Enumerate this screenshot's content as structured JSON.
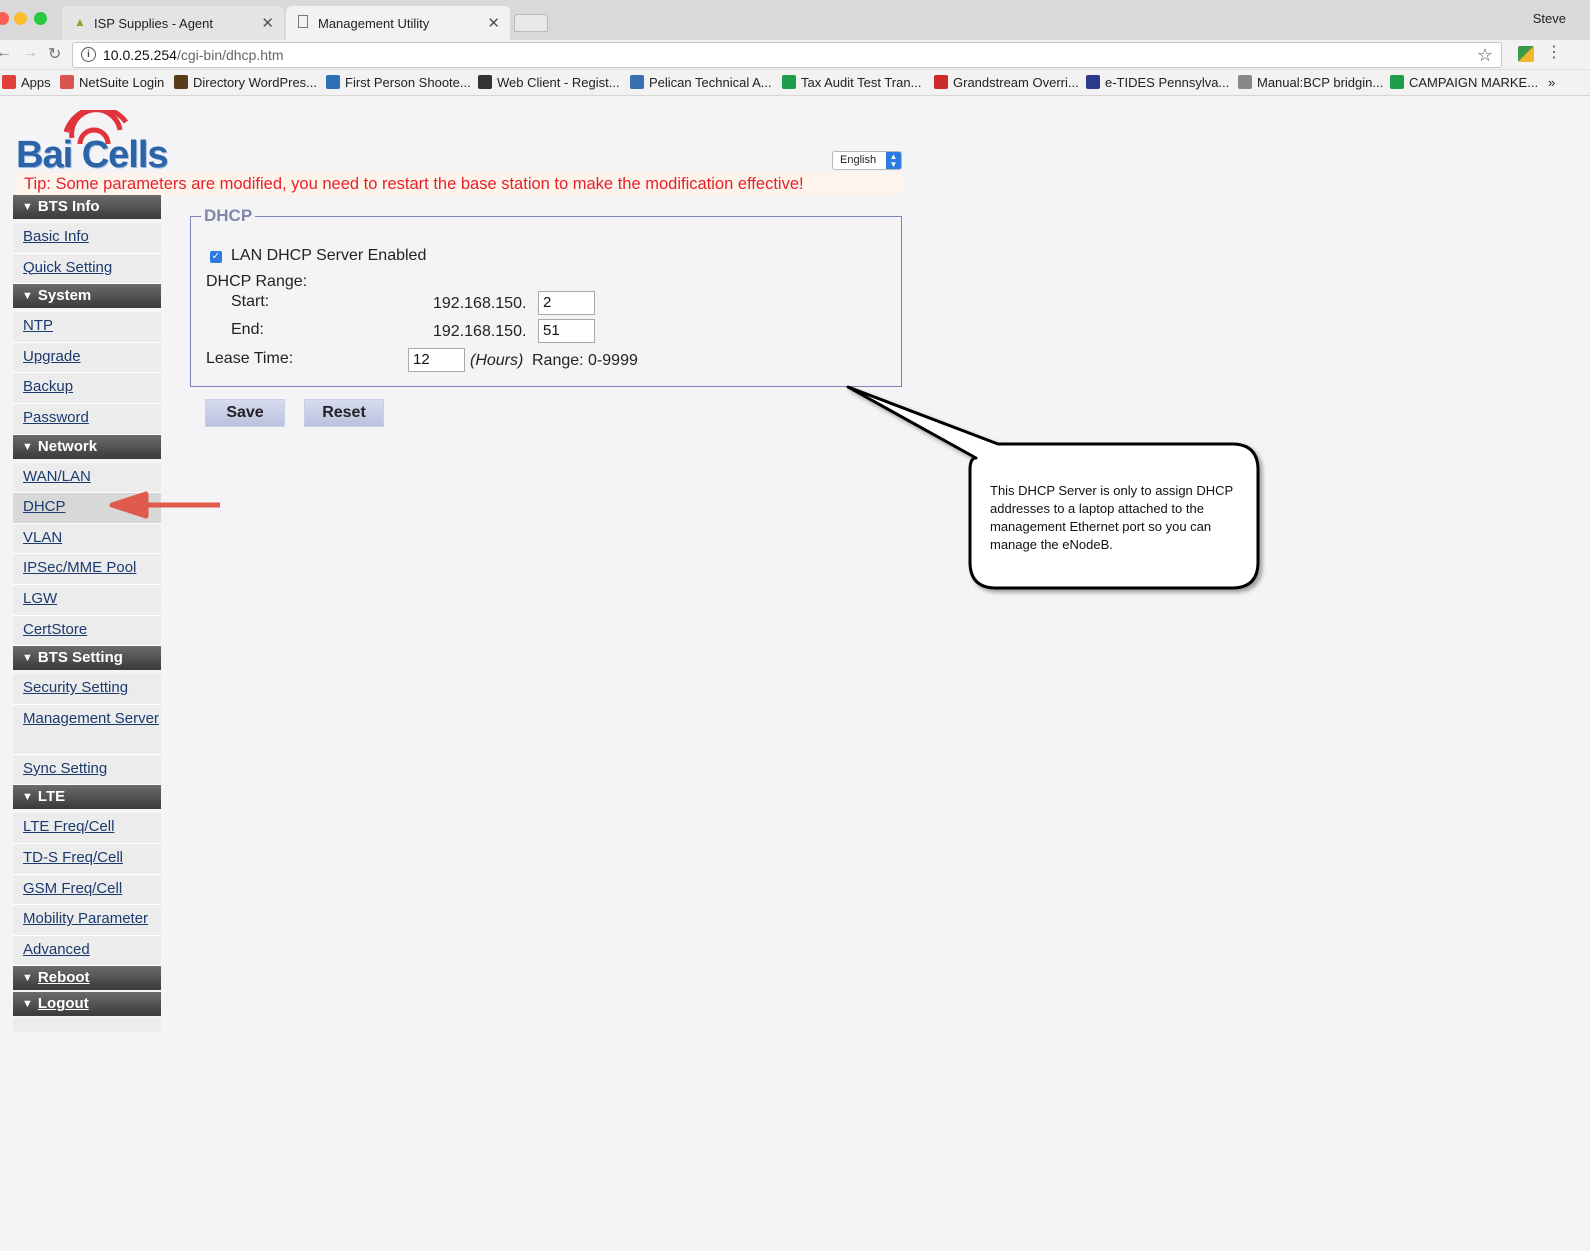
{
  "browser": {
    "tabs": [
      {
        "title": "ISP Supplies - Agent",
        "active": false
      },
      {
        "title": "Management Utility",
        "active": true
      }
    ],
    "user": "Steve",
    "url_host": "10.0.25.254",
    "url_path": "/cgi-bin/dhcp.htm",
    "bookmarks": [
      {
        "label": "Apps",
        "icon": "apps-grid-icon",
        "color": "#e0423a"
      },
      {
        "label": "NetSuite Login",
        "icon": "isp-icon",
        "color": "#d9534f"
      },
      {
        "label": "Directory WordPres...",
        "icon": "book-icon",
        "color": "#5a3b1a"
      },
      {
        "label": "First Person Shoote...",
        "icon": "blocks-icon",
        "color": "#2f6fb4"
      },
      {
        "label": "Web Client - Regist...",
        "icon": "moon-icon",
        "color": "#333333"
      },
      {
        "label": "Pelican Technical A...",
        "icon": "pelican-icon",
        "color": "#3a6fb0"
      },
      {
        "label": "Tax Audit Test Tran...",
        "icon": "sheet-icon",
        "color": "#1e9e4a"
      },
      {
        "label": "Grandstream Overri...",
        "icon": "grandstream-icon",
        "color": "#cc2a2a"
      },
      {
        "label": "e-TIDES Pennsylva...",
        "icon": "pes-icon",
        "color": "#2b3a8a"
      },
      {
        "label": "Manual:BCP bridgin...",
        "icon": "doc-icon",
        "color": "#888888"
      },
      {
        "label": "CAMPAIGN MARKE...",
        "icon": "sheet-icon",
        "color": "#1e9e4a"
      }
    ]
  },
  "header": {
    "logo_text": "Bai Cells",
    "language": "English",
    "tip": "Tip: Some parameters are modified, you need to restart the base station to make the modification effective!"
  },
  "sidebar": {
    "sections": [
      {
        "title": "BTS Info",
        "items": [
          "Basic Info",
          "Quick Setting"
        ]
      },
      {
        "title": "System",
        "items": [
          "NTP",
          "Upgrade",
          "Backup",
          "Password"
        ]
      },
      {
        "title": "Network",
        "items": [
          "WAN/LAN",
          "DHCP",
          "VLAN",
          "IPSec/MME Pool",
          "LGW",
          "CertStore"
        ]
      },
      {
        "title": "BTS Setting",
        "items": [
          "Security Setting",
          "Management Server",
          "Sync Setting"
        ]
      },
      {
        "title": "LTE",
        "items": [
          "LTE Freq/Cell",
          "TD-S Freq/Cell",
          "GSM Freq/Cell",
          "Mobility Parameter",
          "Advanced"
        ]
      },
      {
        "title": "Reboot",
        "items": []
      },
      {
        "title": "Logout",
        "items": []
      }
    ],
    "active_item": "DHCP"
  },
  "dhcp": {
    "legend": "DHCP",
    "server_enabled_label": "LAN DHCP Server Enabled",
    "server_enabled": true,
    "range_label": "DHCP Range:",
    "start_label": "Start:",
    "end_label": "End:",
    "ip_prefix": "192.168.150.",
    "start_value": "2",
    "end_value": "51",
    "lease_label": "Lease Time:",
    "lease_value": "12",
    "lease_unit": "(Hours)",
    "lease_range": "Range: 0-9999"
  },
  "buttons": {
    "save": "Save",
    "reset": "Reset"
  },
  "annotation": {
    "callout_text": "This DHCP Server is only to assign DHCP addresses to a laptop attached to the management Ethernet port so you can manage the eNodeB.",
    "arrow_color": "#e05a4e"
  }
}
